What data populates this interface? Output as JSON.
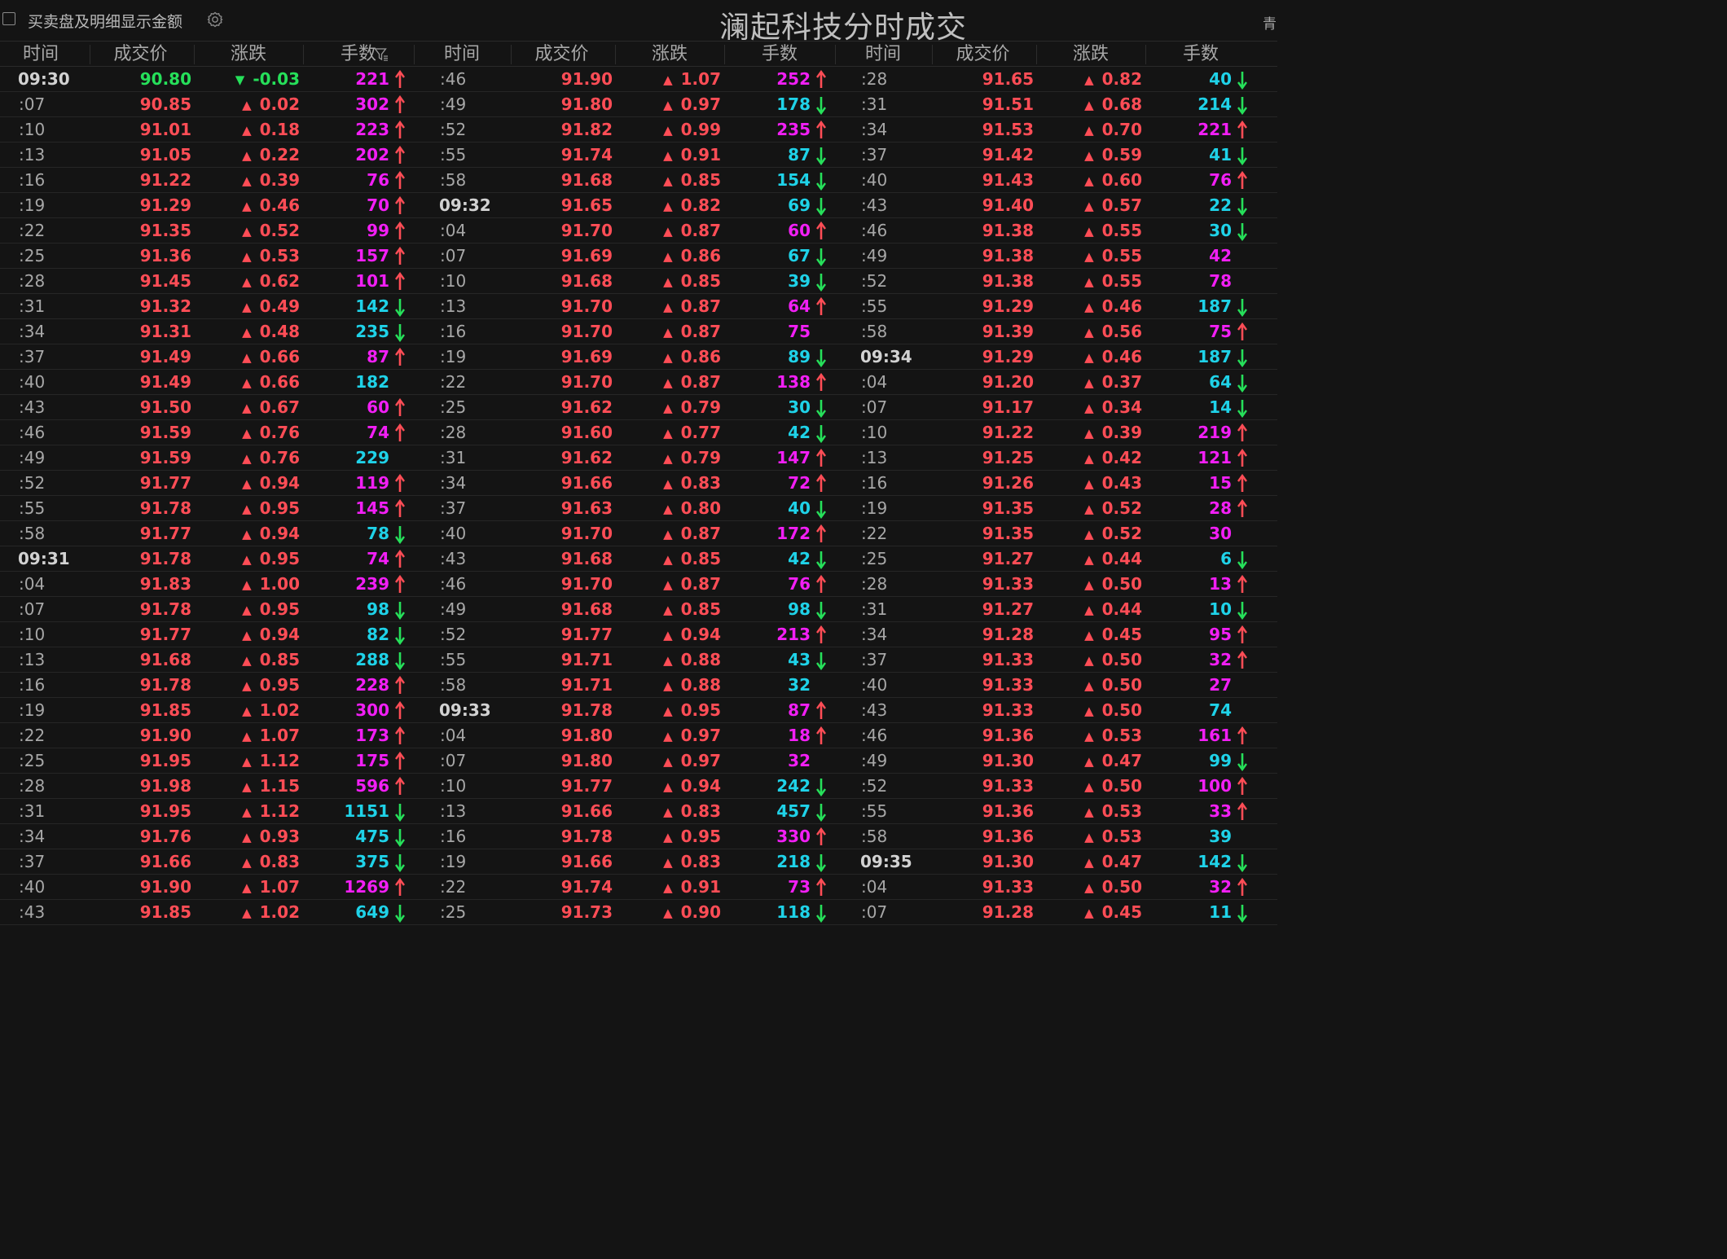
{
  "top": {
    "checkbox_label": "买卖盘及明细显示金额",
    "title": "澜起科技分时成交",
    "corner_text": "青"
  },
  "headers": [
    "时间",
    "成交价",
    "涨跌",
    "手数"
  ],
  "colors": {
    "up": "#ff4d56",
    "down": "#26e05a",
    "buy_volume": "#f21ff5",
    "sell_volume": "#1fd2e8"
  },
  "icons": {
    "settings": "gear-icon",
    "filter": "filter-icon",
    "up_arrow": "up-arrow-icon",
    "down_arrow": "down-arrow-icon"
  },
  "columns": [
    [
      [
        "09:30",
        "90.80",
        "-0.03",
        "221",
        "u"
      ],
      [
        ":07",
        "90.85",
        "0.02",
        "302",
        "u"
      ],
      [
        ":10",
        "91.01",
        "0.18",
        "223",
        "u"
      ],
      [
        ":13",
        "91.05",
        "0.22",
        "202",
        "u"
      ],
      [
        ":16",
        "91.22",
        "0.39",
        "76",
        "u"
      ],
      [
        ":19",
        "91.29",
        "0.46",
        "70",
        "u"
      ],
      [
        ":22",
        "91.35",
        "0.52",
        "99",
        "u"
      ],
      [
        ":25",
        "91.36",
        "0.53",
        "157",
        "u"
      ],
      [
        ":28",
        "91.45",
        "0.62",
        "101",
        "u"
      ],
      [
        ":31",
        "91.32",
        "0.49",
        "142",
        "d"
      ],
      [
        ":34",
        "91.31",
        "0.48",
        "235",
        "d"
      ],
      [
        ":37",
        "91.49",
        "0.66",
        "87",
        "u"
      ],
      [
        ":40",
        "91.49",
        "0.66",
        "182",
        "n"
      ],
      [
        ":43",
        "91.50",
        "0.67",
        "60",
        "u"
      ],
      [
        ":46",
        "91.59",
        "0.76",
        "74",
        "u"
      ],
      [
        ":49",
        "91.59",
        "0.76",
        "229",
        "n"
      ],
      [
        ":52",
        "91.77",
        "0.94",
        "119",
        "u"
      ],
      [
        ":55",
        "91.78",
        "0.95",
        "145",
        "u"
      ],
      [
        ":58",
        "91.77",
        "0.94",
        "78",
        "d"
      ],
      [
        "09:31",
        "91.78",
        "0.95",
        "74",
        "u"
      ],
      [
        ":04",
        "91.83",
        "1.00",
        "239",
        "u"
      ],
      [
        ":07",
        "91.78",
        "0.95",
        "98",
        "d"
      ],
      [
        ":10",
        "91.77",
        "0.94",
        "82",
        "d"
      ],
      [
        ":13",
        "91.68",
        "0.85",
        "288",
        "d"
      ],
      [
        ":16",
        "91.78",
        "0.95",
        "228",
        "u"
      ],
      [
        ":19",
        "91.85",
        "1.02",
        "300",
        "u"
      ],
      [
        ":22",
        "91.90",
        "1.07",
        "173",
        "u"
      ],
      [
        ":25",
        "91.95",
        "1.12",
        "175",
        "u"
      ],
      [
        ":28",
        "91.98",
        "1.15",
        "596",
        "u"
      ],
      [
        ":31",
        "91.95",
        "1.12",
        "1151",
        "d"
      ],
      [
        ":34",
        "91.76",
        "0.93",
        "475",
        "d"
      ],
      [
        ":37",
        "91.66",
        "0.83",
        "375",
        "d"
      ],
      [
        ":40",
        "91.90",
        "1.07",
        "1269",
        "u"
      ],
      [
        ":43",
        "91.85",
        "1.02",
        "649",
        "d"
      ]
    ],
    [
      [
        ":46",
        "91.90",
        "1.07",
        "252",
        "u"
      ],
      [
        ":49",
        "91.80",
        "0.97",
        "178",
        "d"
      ],
      [
        ":52",
        "91.82",
        "0.99",
        "235",
        "u"
      ],
      [
        ":55",
        "91.74",
        "0.91",
        "87",
        "d"
      ],
      [
        ":58",
        "91.68",
        "0.85",
        "154",
        "d"
      ],
      [
        "09:32",
        "91.65",
        "0.82",
        "69",
        "d"
      ],
      [
        ":04",
        "91.70",
        "0.87",
        "60",
        "u"
      ],
      [
        ":07",
        "91.69",
        "0.86",
        "67",
        "d"
      ],
      [
        ":10",
        "91.68",
        "0.85",
        "39",
        "d"
      ],
      [
        ":13",
        "91.70",
        "0.87",
        "64",
        "u"
      ],
      [
        ":16",
        "91.70",
        "0.87",
        "75",
        "n"
      ],
      [
        ":19",
        "91.69",
        "0.86",
        "89",
        "d"
      ],
      [
        ":22",
        "91.70",
        "0.87",
        "138",
        "u"
      ],
      [
        ":25",
        "91.62",
        "0.79",
        "30",
        "d"
      ],
      [
        ":28",
        "91.60",
        "0.77",
        "42",
        "d"
      ],
      [
        ":31",
        "91.62",
        "0.79",
        "147",
        "u"
      ],
      [
        ":34",
        "91.66",
        "0.83",
        "72",
        "u"
      ],
      [
        ":37",
        "91.63",
        "0.80",
        "40",
        "d"
      ],
      [
        ":40",
        "91.70",
        "0.87",
        "172",
        "u"
      ],
      [
        ":43",
        "91.68",
        "0.85",
        "42",
        "d"
      ],
      [
        ":46",
        "91.70",
        "0.87",
        "76",
        "u"
      ],
      [
        ":49",
        "91.68",
        "0.85",
        "98",
        "d"
      ],
      [
        ":52",
        "91.77",
        "0.94",
        "213",
        "u"
      ],
      [
        ":55",
        "91.71",
        "0.88",
        "43",
        "d"
      ],
      [
        ":58",
        "91.71",
        "0.88",
        "32",
        "n"
      ],
      [
        "09:33",
        "91.78",
        "0.95",
        "87",
        "u"
      ],
      [
        ":04",
        "91.80",
        "0.97",
        "18",
        "u"
      ],
      [
        ":07",
        "91.80",
        "0.97",
        "32",
        "n"
      ],
      [
        ":10",
        "91.77",
        "0.94",
        "242",
        "d"
      ],
      [
        ":13",
        "91.66",
        "0.83",
        "457",
        "d"
      ],
      [
        ":16",
        "91.78",
        "0.95",
        "330",
        "u"
      ],
      [
        ":19",
        "91.66",
        "0.83",
        "218",
        "d"
      ],
      [
        ":22",
        "91.74",
        "0.91",
        "73",
        "u"
      ],
      [
        ":25",
        "91.73",
        "0.90",
        "118",
        "d"
      ]
    ],
    [
      [
        ":28",
        "91.65",
        "0.82",
        "40",
        "d"
      ],
      [
        ":31",
        "91.51",
        "0.68",
        "214",
        "d"
      ],
      [
        ":34",
        "91.53",
        "0.70",
        "221",
        "u"
      ],
      [
        ":37",
        "91.42",
        "0.59",
        "41",
        "d"
      ],
      [
        ":40",
        "91.43",
        "0.60",
        "76",
        "u"
      ],
      [
        ":43",
        "91.40",
        "0.57",
        "22",
        "d"
      ],
      [
        ":46",
        "91.38",
        "0.55",
        "30",
        "d"
      ],
      [
        ":49",
        "91.38",
        "0.55",
        "42",
        "n"
      ],
      [
        ":52",
        "91.38",
        "0.55",
        "78",
        "n"
      ],
      [
        ":55",
        "91.29",
        "0.46",
        "187",
        "d"
      ],
      [
        ":58",
        "91.39",
        "0.56",
        "75",
        "u"
      ],
      [
        "09:34",
        "91.29",
        "0.46",
        "187",
        "d"
      ],
      [
        ":04",
        "91.20",
        "0.37",
        "64",
        "d"
      ],
      [
        ":07",
        "91.17",
        "0.34",
        "14",
        "d"
      ],
      [
        ":10",
        "91.22",
        "0.39",
        "219",
        "u"
      ],
      [
        ":13",
        "91.25",
        "0.42",
        "121",
        "u"
      ],
      [
        ":16",
        "91.26",
        "0.43",
        "15",
        "u"
      ],
      [
        ":19",
        "91.35",
        "0.52",
        "28",
        "u"
      ],
      [
        ":22",
        "91.35",
        "0.52",
        "30",
        "n"
      ],
      [
        ":25",
        "91.27",
        "0.44",
        "6",
        "d"
      ],
      [
        ":28",
        "91.33",
        "0.50",
        "13",
        "u"
      ],
      [
        ":31",
        "91.27",
        "0.44",
        "10",
        "d"
      ],
      [
        ":34",
        "91.28",
        "0.45",
        "95",
        "u"
      ],
      [
        ":37",
        "91.33",
        "0.50",
        "32",
        "u"
      ],
      [
        ":40",
        "91.33",
        "0.50",
        "27",
        "n"
      ],
      [
        ":43",
        "91.33",
        "0.50",
        "74",
        "n"
      ],
      [
        ":46",
        "91.36",
        "0.53",
        "161",
        "u"
      ],
      [
        ":49",
        "91.30",
        "0.47",
        "99",
        "d"
      ],
      [
        ":52",
        "91.33",
        "0.50",
        "100",
        "u"
      ],
      [
        ":55",
        "91.36",
        "0.53",
        "33",
        "u"
      ],
      [
        ":58",
        "91.36",
        "0.53",
        "39",
        "n"
      ],
      [
        "09:35",
        "91.30",
        "0.47",
        "142",
        "d"
      ],
      [
        ":04",
        "91.33",
        "0.50",
        "32",
        "u"
      ],
      [
        ":07",
        "91.28",
        "0.45",
        "11",
        "d"
      ]
    ]
  ]
}
